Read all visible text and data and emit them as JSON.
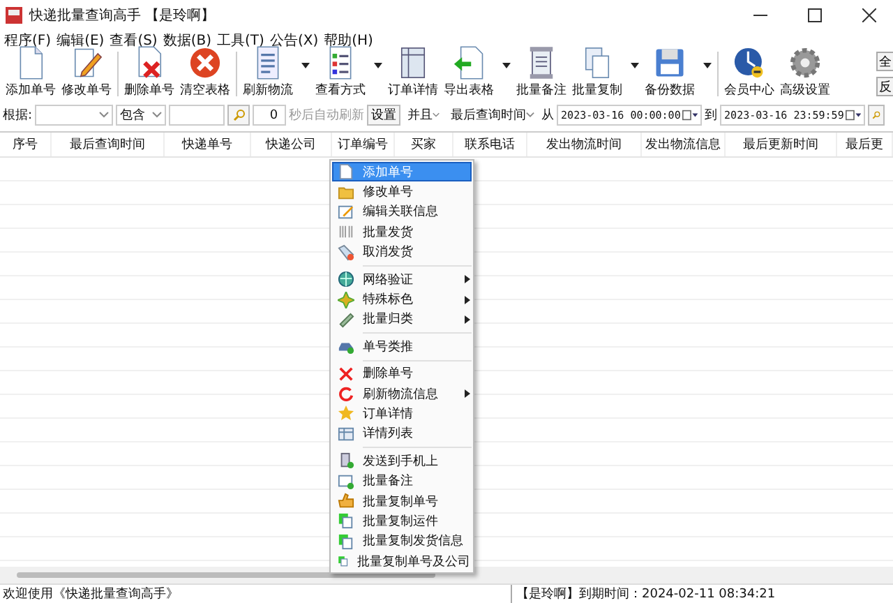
{
  "window": {
    "title": "快递批量查询高手 【是玲啊】"
  },
  "menu_bar": [
    "程序(F)",
    "编辑(E)",
    "查看(S)",
    "数据(B)",
    "工具(T)",
    "公告(X)",
    "帮助(H)"
  ],
  "toolbar": [
    {
      "label": "添加单号",
      "has_dropdown": false
    },
    {
      "label": "修改单号",
      "has_dropdown": false
    },
    {
      "label": "删除单号",
      "has_dropdown": false
    },
    {
      "label": "清空表格",
      "has_dropdown": false
    },
    {
      "label": "刷新物流",
      "has_dropdown": true
    },
    {
      "label": "查看方式",
      "has_dropdown": true
    },
    {
      "label": "订单详情",
      "has_dropdown": false
    },
    {
      "label": "导出表格",
      "has_dropdown": true
    },
    {
      "label": "批量备注",
      "has_dropdown": false
    },
    {
      "label": "批量复制",
      "has_dropdown": true
    },
    {
      "label": "备份数据",
      "has_dropdown": true
    },
    {
      "label": "会员中心",
      "has_dropdown": false
    },
    {
      "label": "高级设置",
      "has_dropdown": false
    }
  ],
  "side_buttons": [
    "全",
    "反"
  ],
  "filter": {
    "by_label": "根据:",
    "match": "包含",
    "countdown": "0",
    "auto_refresh_label": "秒后自动刷新",
    "settings_button": "设置",
    "logic": "并且",
    "time_field": "最后查询时间",
    "from_label": "从",
    "from": "2023-03-16 00:00:00",
    "to_label": "到",
    "to": "2023-03-16 23:59:59"
  },
  "table": {
    "columns": [
      "序号",
      "最后查询时间",
      "快递单号",
      "快递公司",
      "订单编号",
      "买家",
      "联系电话",
      "发出物流时间",
      "发出物流信息",
      "最后更新时间",
      "最后更"
    ]
  },
  "context_menu": {
    "groups": [
      [
        {
          "label": "添加单号",
          "has_submenu": false,
          "selected": true
        },
        {
          "label": "修改单号",
          "has_submenu": false,
          "selected": false
        },
        {
          "label": "编辑关联信息",
          "has_submenu": false,
          "selected": false
        },
        {
          "label": "批量发货",
          "has_submenu": false,
          "selected": false
        },
        {
          "label": "取消发货",
          "has_submenu": false,
          "selected": false
        }
      ],
      [
        {
          "label": "网络验证",
          "has_submenu": true,
          "selected": false
        },
        {
          "label": "特殊标色",
          "has_submenu": true,
          "selected": false
        },
        {
          "label": "批量归类",
          "has_submenu": true,
          "selected": false
        }
      ],
      [
        {
          "label": "单号类推",
          "has_submenu": false,
          "selected": false
        }
      ],
      [
        {
          "label": "删除单号",
          "has_submenu": false,
          "selected": false
        },
        {
          "label": "刷新物流信息",
          "has_submenu": true,
          "selected": false
        },
        {
          "label": "订单详情",
          "has_submenu": false,
          "selected": false
        },
        {
          "label": "详情列表",
          "has_submenu": false,
          "selected": false
        }
      ],
      [
        {
          "label": "发送到手机上",
          "has_submenu": false,
          "selected": false
        },
        {
          "label": "批量备注",
          "has_submenu": false,
          "selected": false
        },
        {
          "label": "批量复制单号",
          "has_submenu": false,
          "selected": false
        },
        {
          "label": "批量复制运件",
          "has_submenu": false,
          "selected": false
        },
        {
          "label": "批量复制发货信息",
          "has_submenu": false,
          "selected": false
        },
        {
          "label": "批量复制单号及公司",
          "has_submenu": false,
          "selected": false
        }
      ]
    ]
  },
  "status_bar": {
    "left": "欢迎使用《快递批量查询高手》",
    "right": "【是玲啊】到期时间：2024-02-11 08:34:21"
  }
}
